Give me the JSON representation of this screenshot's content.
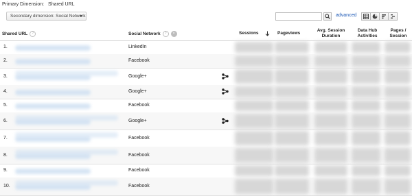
{
  "primary_dimension": {
    "label": "Primary Dimension:",
    "value": "Shared URL"
  },
  "toolbar": {
    "secondary_dimension": "Secondary dimension: Social Network",
    "search_value": "",
    "advanced": "advanced",
    "view_icons": [
      "data-table-icon",
      "pie-chart-icon",
      "performance-bar-icon",
      "comparison-icon"
    ]
  },
  "columns": {
    "shared_url": "Shared URL",
    "social_network": "Social Network",
    "sessions": "Sessions",
    "pageviews": "Pageviews",
    "avg_session_line1": "Avg. Session",
    "avg_session_line2": "Duration",
    "data_hub_line1": "Data Hub",
    "data_hub_line2": "Activities",
    "pages_line1": "Pages /",
    "pages_line2": "Session"
  },
  "rows": [
    {
      "num": "1.",
      "social": "LinkedIn",
      "share": false
    },
    {
      "num": "2.",
      "social": "Facebook",
      "share": false
    },
    {
      "num": "3.",
      "social": "Google+",
      "share": true
    },
    {
      "num": "4.",
      "social": "Google+",
      "share": true
    },
    {
      "num": "5.",
      "social": "Facebook",
      "share": false
    },
    {
      "num": "6.",
      "social": "Google+",
      "share": true
    },
    {
      "num": "7.",
      "social": "Facebook",
      "share": false
    },
    {
      "num": "8.",
      "social": "Facebook",
      "share": false
    },
    {
      "num": "9.",
      "social": "Facebook",
      "share": false
    },
    {
      "num": "10.",
      "social": "Facebook",
      "share": false
    }
  ],
  "colors": {
    "link": "#1a57b5",
    "header_border": "#d4d4d4",
    "blur_url": "#cfe0f2"
  }
}
